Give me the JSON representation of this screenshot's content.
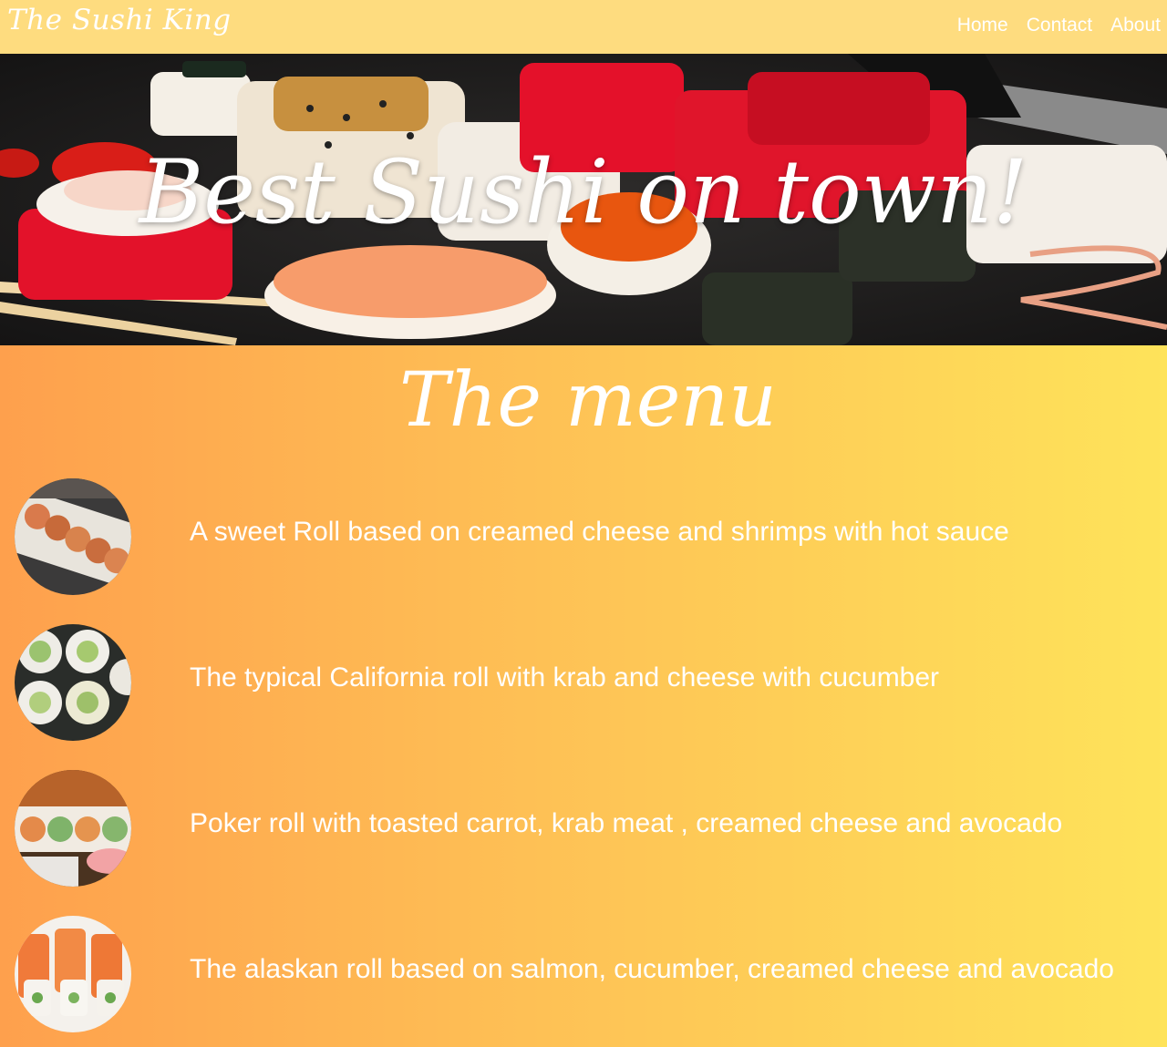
{
  "navbar": {
    "brand": "The Sushi King",
    "links": [
      {
        "label": "Home"
      },
      {
        "label": "Contact"
      },
      {
        "label": "About"
      }
    ]
  },
  "hero": {
    "title": "Best Sushi on town!"
  },
  "menu": {
    "title": "The menu",
    "items": [
      {
        "description": "A sweet Roll based on creamed cheese and shrimps with hot sauce"
      },
      {
        "description": "The typical California roll with krab and cheese with cucumber"
      },
      {
        "description": "Poker roll with toasted carrot, krab meat , creamed cheese and avocado"
      },
      {
        "description": "The alaskan roll based on salmon, cucumber, creamed cheese and avocado"
      }
    ]
  },
  "colors": {
    "navbar": "#fedc7f",
    "gradient_start": "#fea04d",
    "gradient_end": "#fee35a",
    "text": "#ffffff"
  }
}
